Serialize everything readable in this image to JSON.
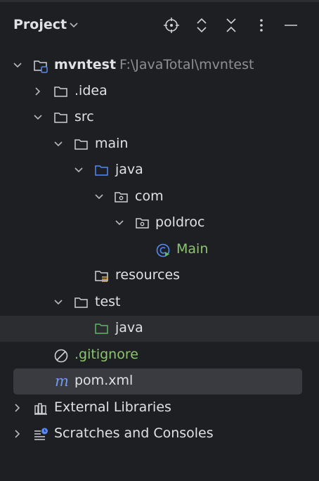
{
  "header": {
    "title": "Project",
    "icons": [
      "locate-icon",
      "expand-collapse-icon",
      "collapse-all-icon",
      "more-options-icon",
      "minimize-icon"
    ]
  },
  "tree": {
    "root_name": "mvntest",
    "root_path": "F:\\JavaTotal\\mvntest",
    "idea": ".idea",
    "src": "src",
    "main": "main",
    "java_main": "java",
    "com": "com",
    "poldroc": "poldroc",
    "main_class": "Main",
    "resources": "resources",
    "test": "test",
    "java_test": "java",
    "gitignore": ".gitignore",
    "pom": "pom.xml",
    "external_libraries": "External Libraries",
    "scratches": "Scratches and Consoles"
  },
  "colors": {
    "background": "#1e1f22",
    "text": "#dfe1e5",
    "muted": "#8c8f94",
    "blue_folder": "#548af7",
    "green": "#8cc46f"
  }
}
